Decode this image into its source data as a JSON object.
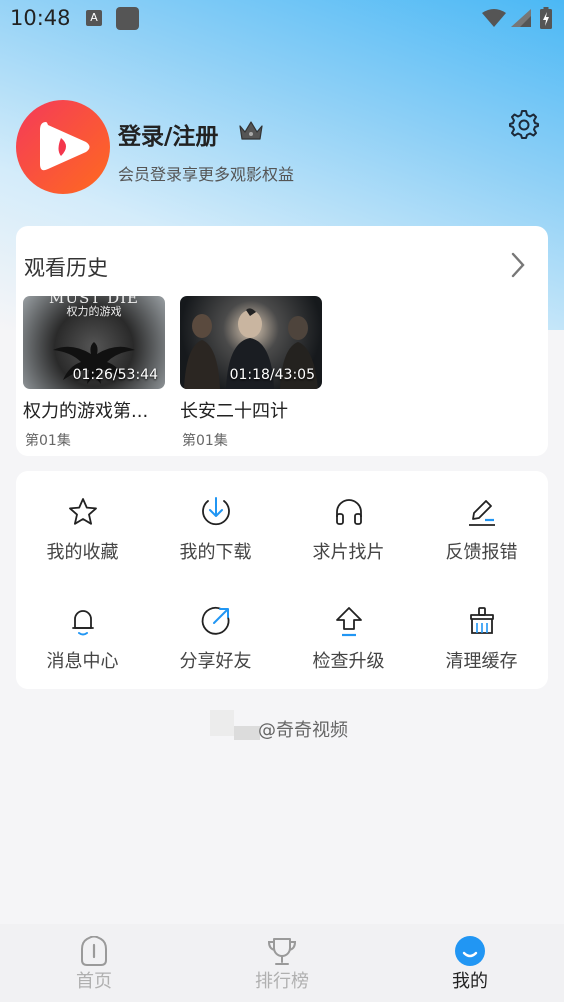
{
  "status_bar": {
    "time": "10:48",
    "notif_a": "A"
  },
  "profile": {
    "title": "登录/注册",
    "subtitle": "会员登录享更多观影权益",
    "crown_icon": "crown-icon",
    "settings_icon": "gear-icon"
  },
  "history": {
    "title": "观看历史",
    "items": [
      {
        "title": "权力的游戏第...",
        "episode": "第01集",
        "progress": "01:26/53:44",
        "poster_line1": "MUST DIE",
        "poster_line2": "权力的游戏"
      },
      {
        "title": "长安二十四计",
        "episode": "第01集",
        "progress": "01:18/43:05"
      }
    ]
  },
  "grid": {
    "items": [
      {
        "label": "我的收藏",
        "icon": "star-icon"
      },
      {
        "label": "我的下载",
        "icon": "download-icon"
      },
      {
        "label": "求片找片",
        "icon": "headphones-icon"
      },
      {
        "label": "反馈报错",
        "icon": "edit-icon"
      },
      {
        "label": "消息中心",
        "icon": "bell-icon"
      },
      {
        "label": "分享好友",
        "icon": "share-icon"
      },
      {
        "label": "检查升级",
        "icon": "upgrade-icon"
      },
      {
        "label": "清理缓存",
        "icon": "clean-icon"
      }
    ]
  },
  "footer": {
    "text": "@奇奇视频"
  },
  "bottom_nav": {
    "items": [
      {
        "label": "首页",
        "icon": "home-icon"
      },
      {
        "label": "排行榜",
        "icon": "trophy-icon"
      },
      {
        "label": "我的",
        "icon": "smile-icon"
      }
    ],
    "active_index": 2
  },
  "colors": {
    "accent": "#2196f3",
    "brand_red": "#f4364c",
    "brand_orange": "#ff7a2e"
  }
}
